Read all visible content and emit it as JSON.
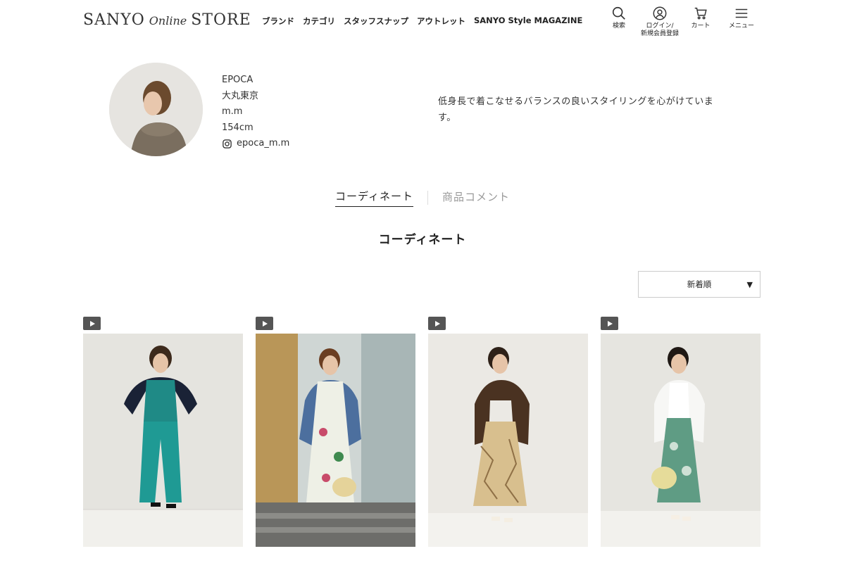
{
  "header": {
    "logo": {
      "part1": "SANYO",
      "part2": "Online",
      "part3": "STORE"
    },
    "nav": [
      "ブランド",
      "カテゴリ",
      "スタッフスナップ",
      "アウトレット",
      "SANYO Style MAGAZINE"
    ],
    "icons": [
      {
        "icon": "search-icon",
        "label": "検索"
      },
      {
        "icon": "user-icon",
        "label": "ログイン/\n新規会員登録"
      },
      {
        "icon": "cart-icon",
        "label": "カート"
      },
      {
        "icon": "menu-icon",
        "label": "メニュー"
      }
    ]
  },
  "profile": {
    "brand": "EPOCA",
    "store": "大丸東京",
    "name": "m.m",
    "height": "154cm",
    "instagram": "epoca_m.m",
    "description": "低身長で着こなせるバランスの良いスタイリングを心がけています。"
  },
  "tabs": [
    {
      "label": "コーディネート",
      "active": true
    },
    {
      "label": "商品コメント",
      "active": false
    }
  ],
  "section_title": "コーディネート",
  "sort": {
    "selected": "新着順"
  },
  "colors": {
    "accent": "#222222",
    "play_badge": "#555555"
  }
}
